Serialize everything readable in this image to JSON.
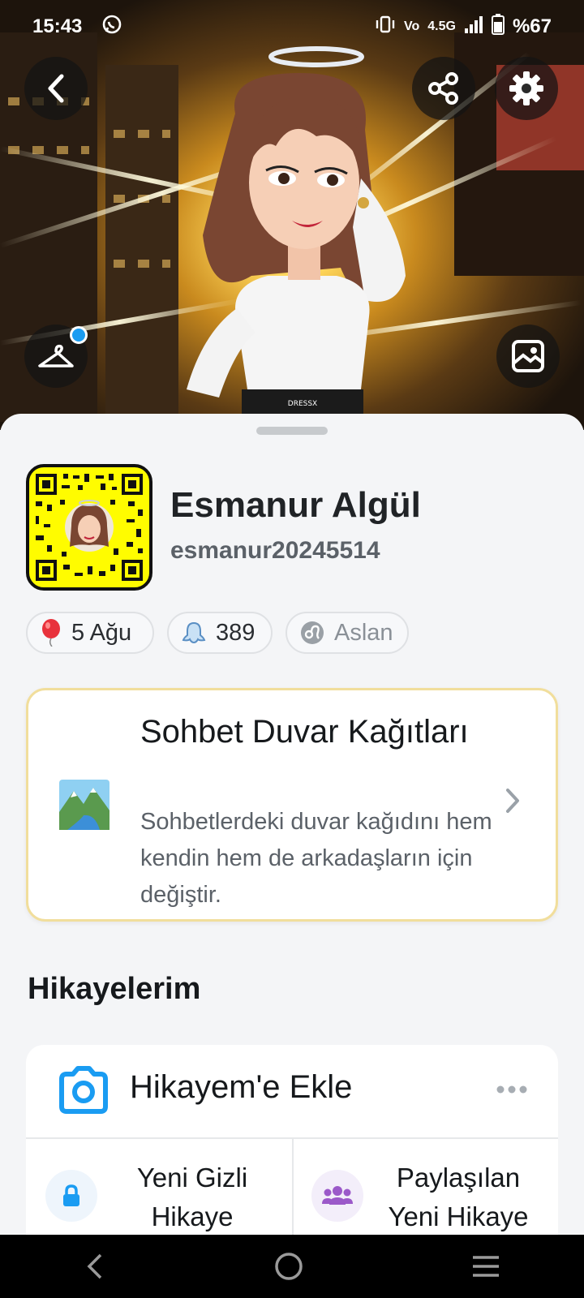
{
  "status_bar": {
    "time": "15:43",
    "network": "4.5G",
    "battery": "%67"
  },
  "profile": {
    "name": "Esmanur Algül",
    "username": "esmanur20245514"
  },
  "pills": [
    {
      "icon": "balloon-icon",
      "label": "5 Ağu"
    },
    {
      "icon": "ghost-icon",
      "label": "389"
    },
    {
      "icon": "leo-zodiac-icon",
      "label": "Aslan"
    }
  ],
  "wallpaper_card": {
    "title": "Sohbet Duvar Kağıtları",
    "description": "Sohbetlerdeki duvar kağıdını hem kendin hem de arkadaşların için değiştir."
  },
  "stories": {
    "section_title": "Hikayelerim",
    "add_label": "Hikayem'e Ekle",
    "private_story_label": "Yeni Gizli Hikaye",
    "shared_story_label": "Paylaşılan Yeni Hikaye"
  },
  "colors": {
    "brand_yellow": "#fffc00",
    "accent_blue": "#1a9cf2",
    "shared_purple": "#9b59c9"
  }
}
